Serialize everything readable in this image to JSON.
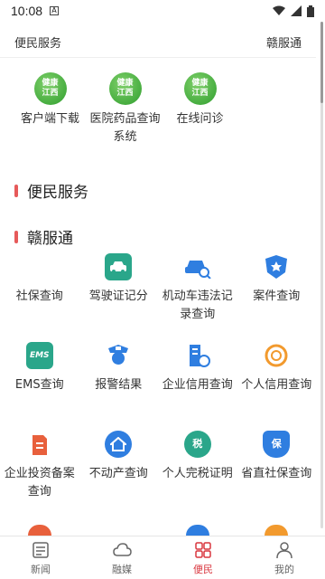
{
  "status": {
    "time": "10:08",
    "notif": "A"
  },
  "topbar": {
    "left": "便民服务",
    "right": "赣服通"
  },
  "apps": [
    {
      "logo_top": "健康",
      "logo_bottom": "江西",
      "label": "客户端下载"
    },
    {
      "logo_top": "健康",
      "logo_bottom": "江西",
      "label": "医院药品查询系统"
    },
    {
      "logo_top": "健康",
      "logo_bottom": "江西",
      "label": "在线问诊"
    }
  ],
  "sections": {
    "first": "便民服务",
    "second": "赣服通"
  },
  "services": [
    {
      "label": "社保查询",
      "icon": "",
      "color": ""
    },
    {
      "label": "驾驶证记分",
      "icon": "car-icon",
      "color": "#2aa68a"
    },
    {
      "label": "机动车违法记录查询",
      "icon": "car-search-icon",
      "color": "#2f7ee0"
    },
    {
      "label": "案件查询",
      "icon": "badge-star-icon",
      "color": "#2f7ee0"
    },
    {
      "label": "EMS查询",
      "icon": "ems-icon",
      "color": "#2aa68a"
    },
    {
      "label": "报警结果",
      "icon": "police-icon",
      "color": "#2f7ee0"
    },
    {
      "label": "企业信用查询",
      "icon": "building-icon",
      "color": "#2f7ee0"
    },
    {
      "label": "个人信用查询",
      "icon": "credit-icon",
      "color": "#f29a2e"
    },
    {
      "label": "企业投资备案查询",
      "icon": "invest-icon",
      "color": "#e8603c"
    },
    {
      "label": "不动产查询",
      "icon": "house-icon",
      "color": "#2f7ee0"
    },
    {
      "label": "个人完税证明",
      "icon": "tax-icon",
      "color": "#2aa68a"
    },
    {
      "label": "省直社保查询",
      "icon": "shield-bao-icon",
      "color": "#2f7ee0"
    }
  ],
  "icon_text": {
    "ems": "EMS",
    "tax": "税",
    "bao": "保"
  },
  "nav": [
    {
      "label": "新闻",
      "icon": "news-icon",
      "active": false
    },
    {
      "label": "融媒",
      "icon": "cloud-icon",
      "active": false
    },
    {
      "label": "便民",
      "icon": "grid-icon",
      "active": true
    },
    {
      "label": "我的",
      "icon": "user-icon",
      "active": false
    }
  ]
}
